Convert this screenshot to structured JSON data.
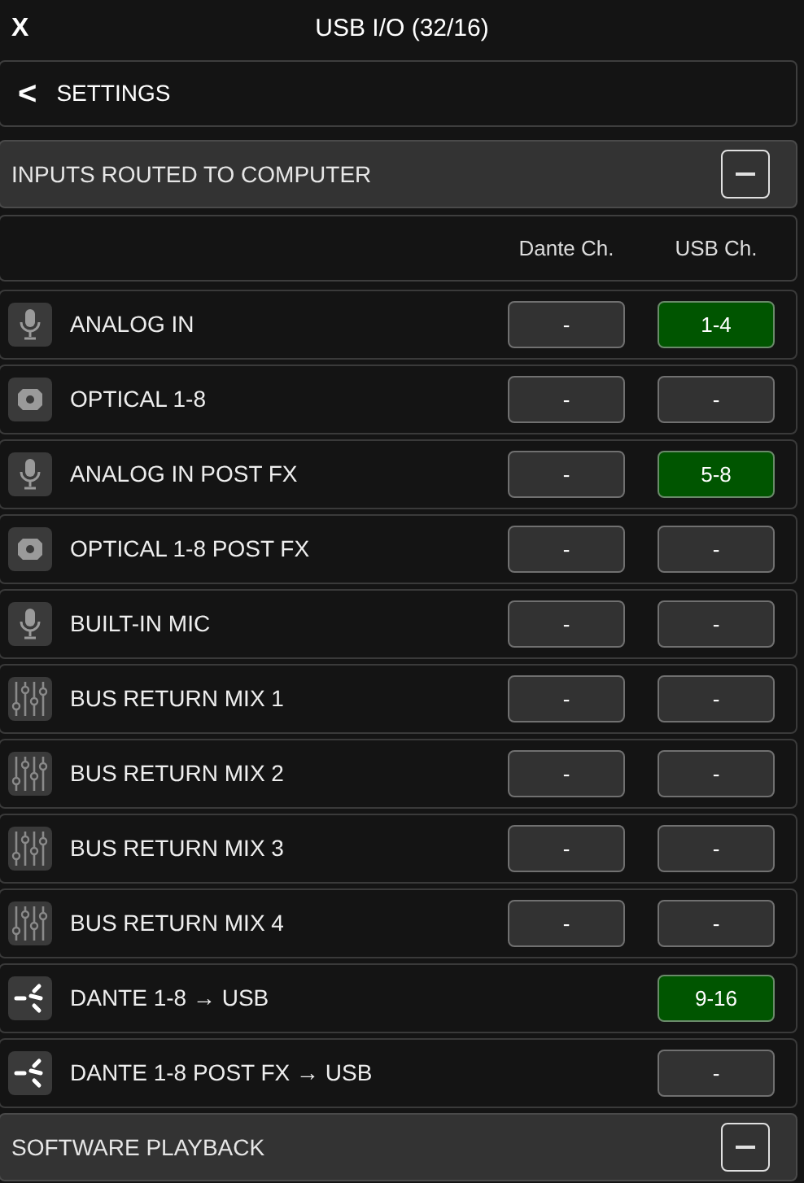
{
  "header": {
    "close": "X",
    "title": "USB I/O (32/16)"
  },
  "back": {
    "chevron": "<",
    "label": "SETTINGS"
  },
  "sections": [
    {
      "title": "INPUTS ROUTED TO COMPUTER",
      "expanded": true,
      "columns": [
        "Dante Ch.",
        "USB Ch."
      ],
      "rows": [
        {
          "kind": "mic",
          "label": "ANALOG IN",
          "dante": {
            "text": "-",
            "assigned": false
          },
          "usb": {
            "text": "1-4",
            "assigned": true
          }
        },
        {
          "kind": "optical",
          "label": "OPTICAL 1-8",
          "dante": {
            "text": "-",
            "assigned": false
          },
          "usb": {
            "text": "-",
            "assigned": false
          }
        },
        {
          "kind": "mic",
          "label": "ANALOG IN POST FX",
          "dante": {
            "text": "-",
            "assigned": false
          },
          "usb": {
            "text": "5-8",
            "assigned": true
          }
        },
        {
          "kind": "optical",
          "label": "OPTICAL 1-8 POST FX",
          "dante": {
            "text": "-",
            "assigned": false
          },
          "usb": {
            "text": "-",
            "assigned": false
          }
        },
        {
          "kind": "mic",
          "label": "BUILT-IN MIC",
          "dante": {
            "text": "-",
            "assigned": false
          },
          "usb": {
            "text": "-",
            "assigned": false
          }
        },
        {
          "kind": "mixer",
          "label": "BUS RETURN MIX 1",
          "dante": {
            "text": "-",
            "assigned": false
          },
          "usb": {
            "text": "-",
            "assigned": false
          }
        },
        {
          "kind": "mixer",
          "label": "BUS RETURN MIX 2",
          "dante": {
            "text": "-",
            "assigned": false
          },
          "usb": {
            "text": "-",
            "assigned": false
          }
        },
        {
          "kind": "mixer",
          "label": "BUS RETURN MIX 3",
          "dante": {
            "text": "-",
            "assigned": false
          },
          "usb": {
            "text": "-",
            "assigned": false
          }
        },
        {
          "kind": "mixer",
          "label": "BUS RETURN MIX 4",
          "dante": {
            "text": "-",
            "assigned": false
          },
          "usb": {
            "text": "-",
            "assigned": false
          }
        },
        {
          "kind": "dante",
          "label": "DANTE 1-8 → USB",
          "usb": {
            "text": "9-16",
            "assigned": true
          }
        },
        {
          "kind": "dante",
          "label": "DANTE 1-8 POST FX → USB",
          "usb": {
            "text": "-",
            "assigned": false
          }
        }
      ]
    },
    {
      "title": "SOFTWARE PLAYBACK",
      "expanded": true
    }
  ]
}
